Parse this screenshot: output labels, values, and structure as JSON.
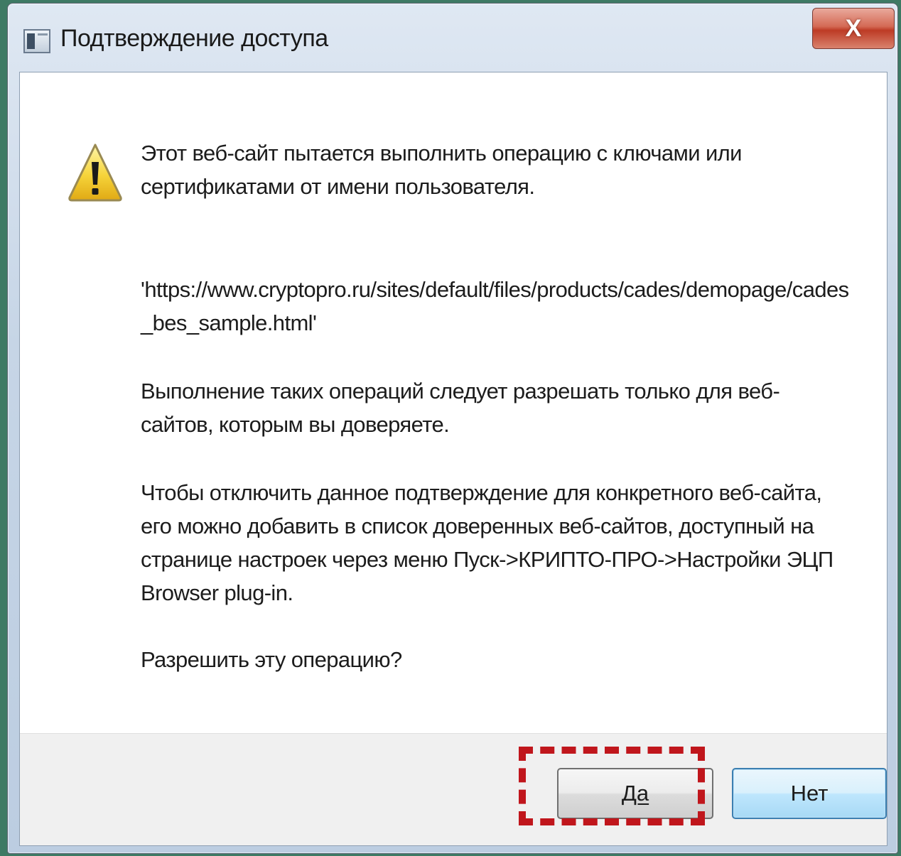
{
  "window": {
    "title": "Подтверждение доступа",
    "close_label": "X"
  },
  "dialog": {
    "icon": "warning-icon",
    "message_1": "Этот веб-сайт пытается выполнить операцию с ключами или сертификатами от имени пользователя.",
    "message_2": "'https://www.cryptopro.ru/sites/default/files/products/cades/demopage/cades_bes_sample.html'",
    "message_3": "Выполнение таких операций следует разрешать только для веб-сайтов, которым вы доверяете.",
    "message_4": "Чтобы отключить данное подтверждение для конкретного веб-сайта, его можно добавить в список доверенных веб-сайтов, доступный на странице настроек через меню Пуск->КРИПТО-ПРО->Настройки ЭЦП Browser plug-in.",
    "message_5": "Разрешить эту операцию?"
  },
  "buttons": {
    "yes_label": "Да",
    "no_label": "Нет"
  },
  "annotation": {
    "highlight_color": "#c0161c",
    "highlight_target": "yes-button"
  },
  "colors": {
    "desktop_background": "#3e7a64",
    "close_button": "#c7452d",
    "default_button_border": "#3c7fb1"
  }
}
